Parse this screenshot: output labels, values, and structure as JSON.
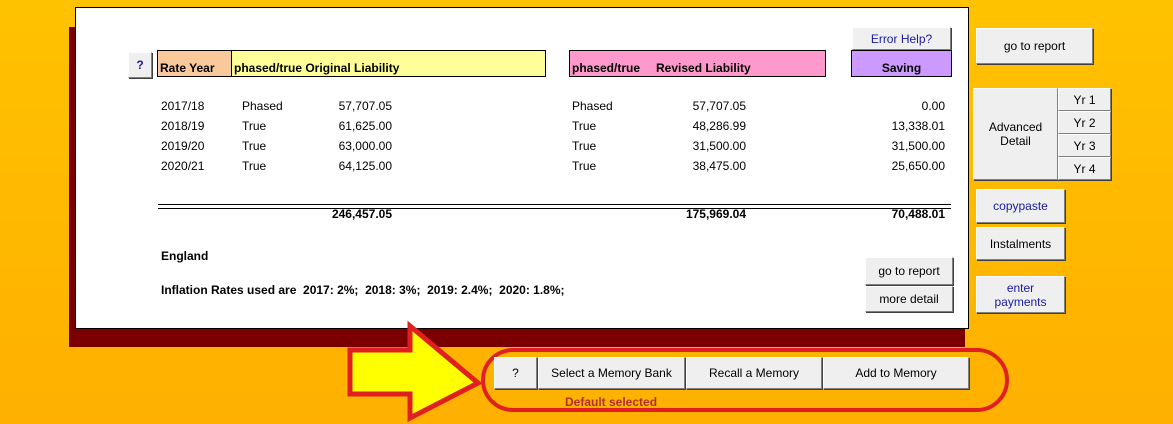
{
  "header": {
    "help_q": "?",
    "rate_year": "Rate Year",
    "original_liability": "phased/true Original Liability",
    "phased_true": "phased/true",
    "revised_liability": "Revised Liability",
    "saving": "Saving",
    "error_help": "Error Help?"
  },
  "rows": [
    {
      "year": "2017/18",
      "type1": "Phased",
      "orig": "57,707.05",
      "type2": "Phased",
      "rev": "57,707.05",
      "saving": "0.00"
    },
    {
      "year": "2018/19",
      "type1": "True",
      "orig": "61,625.00",
      "type2": "True",
      "rev": "48,286.99",
      "saving": "13,338.01"
    },
    {
      "year": "2019/20",
      "type1": "True",
      "orig": "63,000.00",
      "type2": "True",
      "rev": "31,500.00",
      "saving": "31,500.00"
    },
    {
      "year": "2020/21",
      "type1": "True",
      "orig": "64,125.00",
      "type2": "True",
      "rev": "38,475.00",
      "saving": "25,650.00"
    }
  ],
  "totals": {
    "orig": "246,457.05",
    "rev": "175,969.04",
    "saving": "70,488.01"
  },
  "region": "England",
  "inflation": "Inflation Rates used are  2017: 2%;  2018: 3%;  2019: 2.4%;  2020: 1.8%;",
  "panel_buttons": {
    "go_to_report": "go to report",
    "more_detail": "more detail"
  },
  "side": {
    "go_to_report": "go to report",
    "advanced_detail": "Advanced Detail",
    "years": [
      "Yr 1",
      "Yr 2",
      "Yr 3",
      "Yr 4"
    ],
    "copypaste": "copypaste",
    "instalments": "Instalments",
    "enter_payments": "enter payments"
  },
  "memory": {
    "help": "?",
    "select": "Select a Memory Bank",
    "recall": "Recall a Memory",
    "add": "Add to Memory",
    "status": "Default selected"
  },
  "colors": {
    "rate_year_bg": "#f9c89b",
    "original_bg": "#ffff99",
    "revised_bg": "#ff99cc",
    "saving_bg": "#cc99ff",
    "annotation_red": "#e02020",
    "arrow_fill": "#ffff00",
    "status_text": "#b03030"
  }
}
